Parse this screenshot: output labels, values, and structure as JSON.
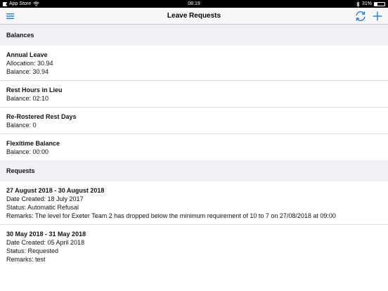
{
  "status_bar": {
    "carrier": "App Store",
    "time": "08:19",
    "battery": "31%",
    "battery_level": 0.31
  },
  "nav": {
    "title": "Leave Requests",
    "menu_icon": "hamburger-menu-icon",
    "refresh_icon": "refresh-icon",
    "add_icon": "plus-icon",
    "accent_color": "#1a7ee8"
  },
  "balances": {
    "header": "Balances",
    "items": [
      {
        "title": "Annual Leave",
        "lines": [
          "Allocation: 30.94",
          "Balance: 30.94"
        ]
      },
      {
        "title": "Rest Hours in Lieu",
        "lines": [
          "Balance: 02:10"
        ]
      },
      {
        "title": "Re-Rostered Rest Days",
        "lines": [
          "Balance: 0"
        ]
      },
      {
        "title": "Flexitime Balance",
        "lines": [
          "Balance: 00:00"
        ]
      }
    ]
  },
  "requests": {
    "header": "Requests",
    "items": [
      {
        "title": "27 August 2018 - 30 August 2018",
        "lines": [
          "Date Created: 18 July 2017",
          "Status: Automatic Refusal",
          "Remarks: The level for Exeter Team 2 has dropped below the minimum requirement of 10 to 7 on 27/08/2018 at 09:00"
        ]
      },
      {
        "title": "30 May 2018 - 31 May 2018",
        "lines": [
          "Date Created: 05 April 2018",
          "Status: Requested",
          "Remarks: test"
        ]
      }
    ]
  }
}
